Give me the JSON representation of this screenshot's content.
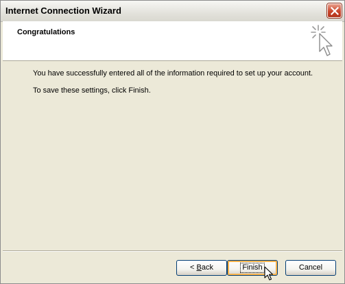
{
  "window": {
    "title": "Internet Connection Wizard"
  },
  "header": {
    "title": "Congratulations"
  },
  "content": {
    "line1": "You have successfully entered all of the information required to set up your account.",
    "line2": "To save these settings, click Finish."
  },
  "buttons": {
    "back": {
      "accel": "B",
      "rest": "ack",
      "prefix": "< "
    },
    "finish": "Finish",
    "cancel": "Cancel"
  },
  "icons": {
    "close": "close-icon",
    "wizard": "wizard-sparkle-cursor-icon",
    "cursor": "mouse-pointer-icon"
  },
  "colors": {
    "title_close": "#c9452b",
    "focus_ring": "#f9b34c",
    "button_border": "#003c74"
  }
}
